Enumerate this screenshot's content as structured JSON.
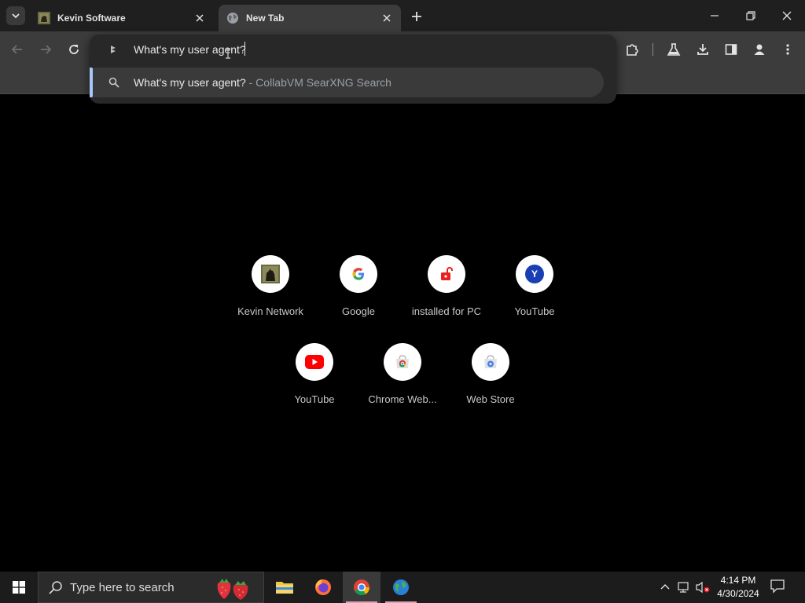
{
  "tabs": [
    {
      "title": "Kevin Software",
      "favicon": "kevin-network-favicon",
      "active": false
    },
    {
      "title": "New Tab",
      "favicon": "globe-icon",
      "active": true
    }
  ],
  "omnibox": {
    "query": "What's my user agent?",
    "suggestion_primary": "What's my user agent?",
    "suggestion_secondary": " - CollabVM SearXNG Search"
  },
  "shortcuts": [
    {
      "label": "Kevin Network",
      "icon": "kevin-network-icon"
    },
    {
      "label": "Google",
      "icon": "google-g-icon"
    },
    {
      "label": "installed for PC",
      "icon": "unlock-icon"
    },
    {
      "label": "YouTube",
      "icon": "y-letter-icon",
      "letter": "Y"
    },
    {
      "label": "YouTube",
      "icon": "youtube-play-icon"
    },
    {
      "label": "Chrome Web...",
      "icon": "chrome-web-store-icon"
    },
    {
      "label": "Web Store",
      "icon": "web-store-icon"
    }
  ],
  "taskbar": {
    "search_placeholder": "Type here to search",
    "time": "4:14 PM",
    "date": "4/30/2024",
    "apps": [
      "file-explorer-icon",
      "firefox-icon",
      "chrome-icon",
      "globe-app-icon"
    ]
  },
  "colors": {
    "tab_strip": "#1f1f1f",
    "toolbar": "#3c3c3c",
    "omnibox_popup": "#282828",
    "suggestion_highlight": "#3a3a3a",
    "accent_bar": "#a8c7fa",
    "ntp_background": "#000000",
    "taskbar": "#1c1c1c"
  }
}
